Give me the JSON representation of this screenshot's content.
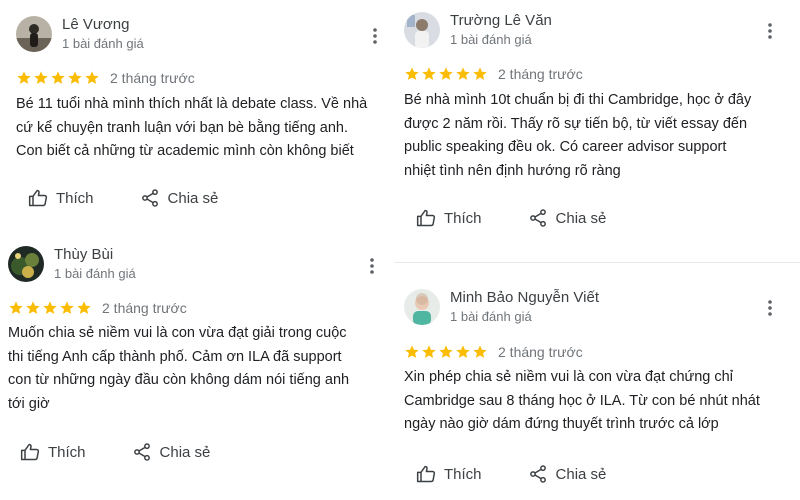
{
  "common": {
    "like_label": "Thích",
    "share_label": "Chia sẻ",
    "star_color": "#fbbc04",
    "icons": {
      "star": "star-icon",
      "like": "thumbs-up-icon",
      "share": "share-icon",
      "more": "more-vertical-icon"
    }
  },
  "reviews": [
    {
      "author": "Lê Vương",
      "review_count": "1 bài đánh giá",
      "rating": 5,
      "date": "2 tháng trước",
      "text_lines": [
        "Bé 11 tuổi nhà mình thích nhất là debate class. Về nhà",
        "cứ kể chuyện tranh luận với bạn bè bằng tiếng anh.",
        "Con biết cả những từ academic mình còn không biết"
      ]
    },
    {
      "author": "Thùy Bùi",
      "review_count": "1 bài đánh giá",
      "rating": 5,
      "date": "2 tháng trước",
      "text_lines": [
        "Muốn chia sẻ niềm vui là con vừa đạt giải trong cuộc",
        "thi tiếng Anh cấp thành phố. Cảm ơn ILA đã support",
        "con từ những ngày đầu còn không dám nói tiếng anh",
        "tới giờ"
      ]
    },
    {
      "author": "Trường Lê Văn",
      "review_count": "1 bài đánh giá",
      "rating": 5,
      "date": "2 tháng trước",
      "text_lines": [
        "Bé nhà mình 10t chuẩn bị đi thi Cambridge, học ở đây",
        "được 2 năm rồi. Thấy rõ sự tiến bộ, từ viết essay đến",
        "public speaking đều ok. Có career advisor support",
        "nhiệt tình nên định hướng rõ ràng"
      ]
    },
    {
      "author": "Minh Bảo Nguyễn Viết",
      "review_count": "1 bài đánh giá",
      "rating": 5,
      "date": "2 tháng trước",
      "text_lines": [
        "Xin phép chia sẻ niềm vui là con vừa đạt chứng chỉ",
        "Cambridge sau 8 tháng học ở ILA. Từ con bé nhút nhát",
        "ngày nào giờ dám đứng thuyết trình trước cả lớp"
      ]
    }
  ]
}
